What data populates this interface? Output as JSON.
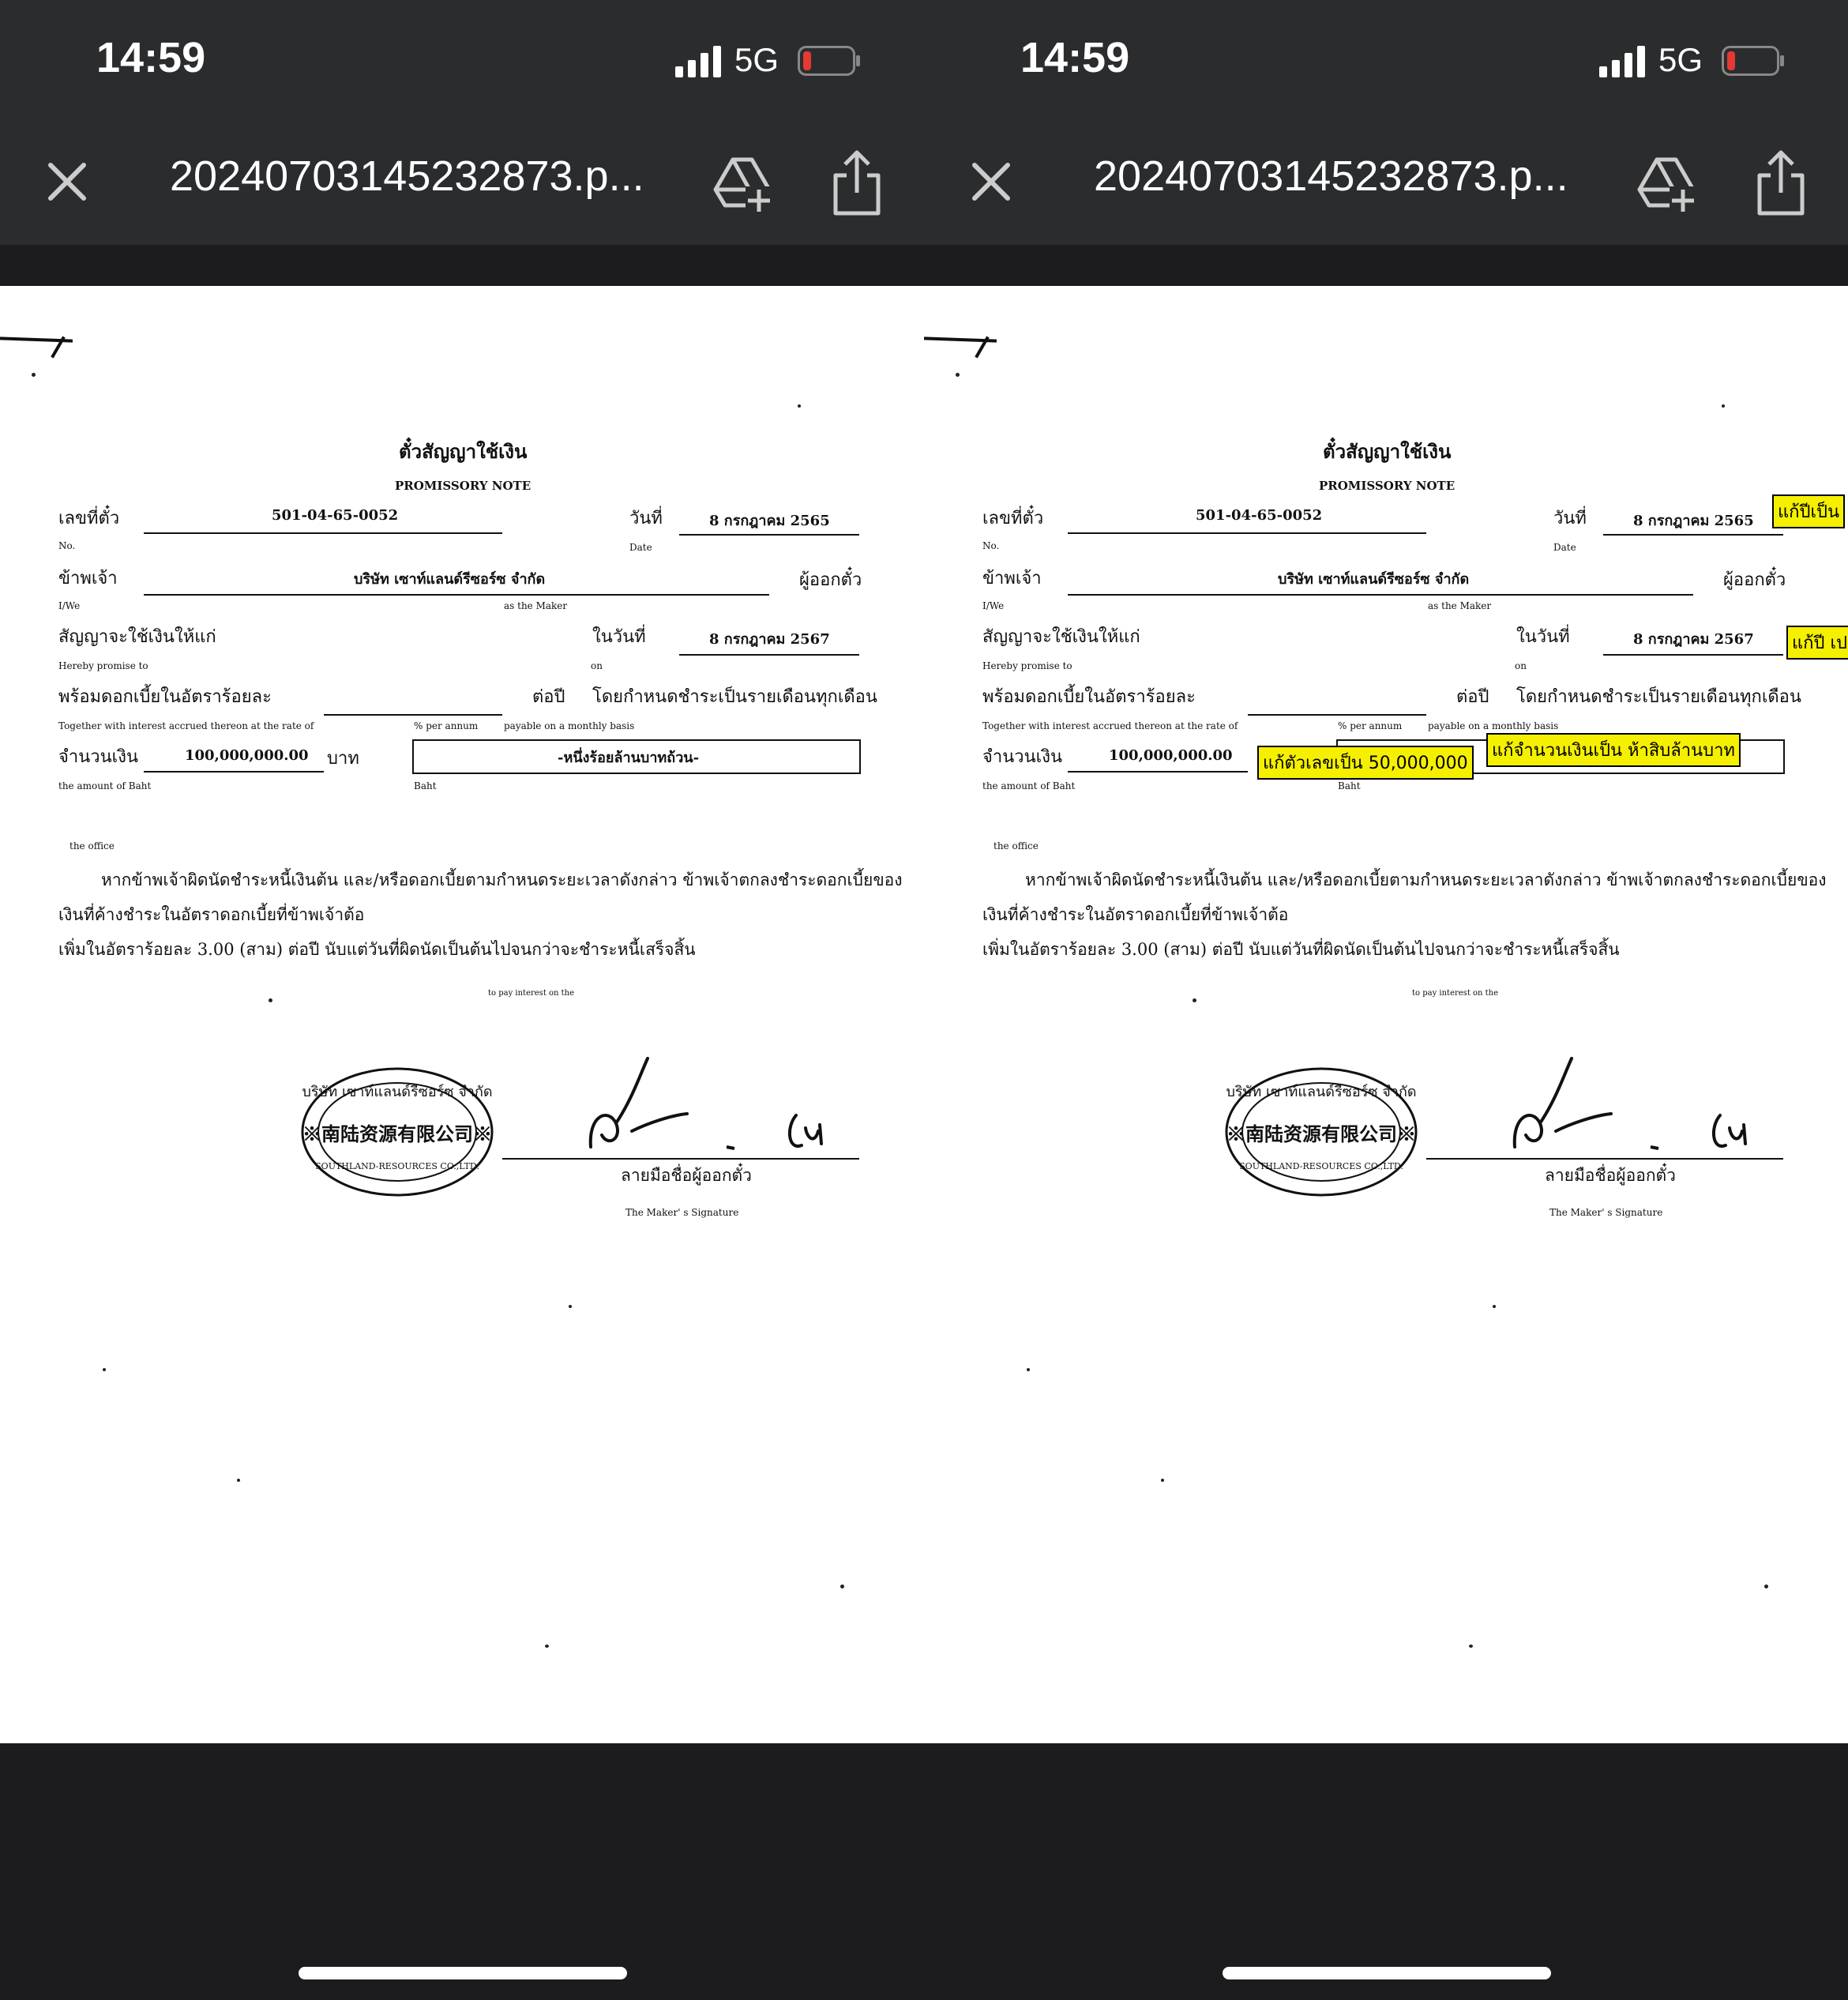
{
  "status": {
    "time": "14:59",
    "network": "5G"
  },
  "viewer": {
    "title": "20240703145232873.p..."
  },
  "note": {
    "title_th": "ตั๋วสัญญาใช้เงิน",
    "title_en": "PROMISSORY NOTE",
    "no_label_th": "เลขที่ตั๋ว",
    "no_label_en": "No.",
    "no_value": "501-04-65-0052",
    "date_label_th": "วันที่",
    "date_label_en": "Date",
    "date_value": "8  กรกฎาคม  2565",
    "iwe_label_th": "ข้าพเจ้า",
    "iwe_label_en": "I/We",
    "maker_value": "บริษัท  เซาท์แลนด์รีซอร์ซ จำกัด",
    "maker_label_th": "ผู้ออกตั๋ว",
    "maker_label_en": "as the Maker",
    "promise_label_th": "สัญญาจะใช้เงินให้แก่",
    "promise_label_en": "Hereby promise to",
    "on_label_th": "ในวันที่",
    "on_label_en": "on",
    "due_value": "8  กรกฎาคม  2567",
    "interest_label_th": "พร้อมดอกเบี้ยในอัตราร้อยละ",
    "interest_label_en": "Together with interest accrued thereon at the rate of",
    "per_annum_th": "ต่อปี",
    "per_annum_en": "% per annum",
    "monthly_th": "โดยกำหนดชำระเป็นรายเดือนทุกเดือน",
    "monthly_en": "payable on a monthly basis",
    "amount_label_th": "จำนวนเงิน",
    "amount_label_en": "the amount of Baht",
    "amount_value": "100,000,000.00",
    "baht_th": "บาท",
    "baht_en": "Baht",
    "amount_words": "-หนึ่งร้อยล้านบาทถ้วน-",
    "office_fragment": "the office",
    "default_line1": "หากข้าพเจ้าผิดนัดชำระหนี้เงินต้น  และ/หรือดอกเบี้ยตามกำหนดระยะเวลาดังกล่าว    ข้าพเจ้าตกลงชำระดอกเบี้ยของ",
    "default_line2": "เงินที่ค้างชำระในอัตราดอกเบี้ยที่ข้าพเจ้าต้อ",
    "default_line3": "เพิ่มในอัตราร้อยละ 3.00 (สาม) ต่อปี นับแต่วันที่ผิดนัดเป็นต้นไปจนกว่าจะชำระหนี้เสร็จสิ้น",
    "interest_fragment": "to pay interest on the",
    "signature_label_th": "ลายมือชื่อผู้ออกตั๋ว",
    "signature_label_en": "The Maker' s Signature",
    "stamp_top": "บริษัท เซาท์แลนด์รีซอร์ซ จำกัด",
    "stamp_middle": "※南陆资源有限公司※",
    "stamp_bottom": "SOUTHLAND-RESOURCES CO.,LTD."
  },
  "annotations": {
    "year_fix": "แก้ปีเป็น",
    "year_fix2": "แก้ปี เป",
    "number_fix": "แก้ตัวเลขเป็น 50,000,000",
    "words_fix": "แก้จำนวนเงินเป็น ห้าสิบล้านบาท"
  },
  "icons": [
    "close-icon",
    "drive-add-icon",
    "share-icon",
    "signal-icon",
    "battery-icon"
  ],
  "colors": {
    "bar": "#2b2c2e",
    "background": "#1c1c1e",
    "annotation": "#f5f000",
    "battery_low": "#e53935"
  }
}
